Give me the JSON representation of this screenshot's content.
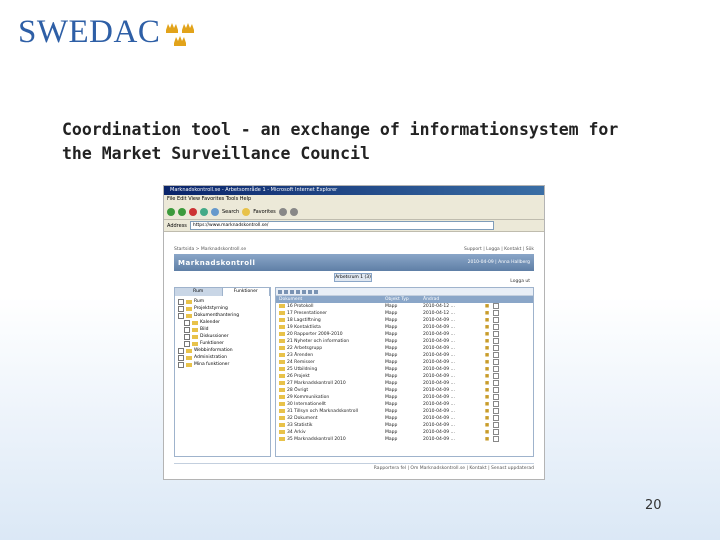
{
  "logo": {
    "text": "SWEDAC"
  },
  "slide": {
    "title_line1": "Coordination tool - an exchange of informationsystem for",
    "title_line2": "the Market Surveillance Council",
    "page_number": "20"
  },
  "browser": {
    "window_title": "Marknadskontroll.se - Arbetsområde 1 - Microsoft Internet Explorer",
    "menu": "File  Edit  View  Favorites  Tools  Help",
    "toolbar": {
      "search_label": "Search",
      "favorites_label": "Favorites"
    },
    "address_label": "Address",
    "address_value": "https://www.marknadskontroll.se/"
  },
  "app": {
    "breadcrumb": "Startsida > Marknadskontroll.se",
    "top_links": "Support | Logga | Kontakt | Sök",
    "title": "Marknadskontroll",
    "user_date": "2010-04-09 | Anna Hallberg",
    "center_tab": "Arbetsrum 1 (3)",
    "logout": "Logga ut",
    "left_tabs": [
      "Rum",
      "Funktioner"
    ],
    "tree": [
      "Rum",
      "Projektstyrning",
      "Dokumenthantering",
      "Kalender",
      "Bild",
      "Diskussioner",
      "Funktioner",
      "Webbinformation",
      "Administration",
      "Mina funktioner"
    ],
    "table": {
      "headers": [
        "Dokument",
        "Objekt Typ",
        "Ändrad"
      ],
      "rows": [
        [
          "16 Protokoll",
          "Mapp",
          "2010-04-12 ..."
        ],
        [
          "17 Presentationer",
          "Mapp",
          "2010-04-12 ..."
        ],
        [
          "18 Lagstiftning",
          "Mapp",
          "2010-04-09 ..."
        ],
        [
          "19 Kontaktlista",
          "Mapp",
          "2010-04-09 ..."
        ],
        [
          "20 Rapporter 2009-2010",
          "Mapp",
          "2010-04-09 ..."
        ],
        [
          "21 Nyheter och information",
          "Mapp",
          "2010-04-09 ..."
        ],
        [
          "22 Arbetsgrupp",
          "Mapp",
          "2010-04-09 ..."
        ],
        [
          "23 Ärenden",
          "Mapp",
          "2010-04-09 ..."
        ],
        [
          "24 Remisser",
          "Mapp",
          "2010-04-09 ..."
        ],
        [
          "25 Utbildning",
          "Mapp",
          "2010-04-09 ..."
        ],
        [
          "26 Projekt",
          "Mapp",
          "2010-04-09 ..."
        ],
        [
          "27 Marknadskontroll 2010",
          "Mapp",
          "2010-04-09 ..."
        ],
        [
          "28 Övrigt",
          "Mapp",
          "2010-04-09 ..."
        ],
        [
          "29 Kommunikation",
          "Mapp",
          "2010-04-09 ..."
        ],
        [
          "30 Internationellt",
          "Mapp",
          "2010-04-09 ..."
        ],
        [
          "31 Tillsyn och Marknadskontroll",
          "Mapp",
          "2010-04-09 ..."
        ],
        [
          "32 Dokument",
          "Mapp",
          "2010-04-09 ..."
        ],
        [
          "33 Statistik",
          "Mapp",
          "2010-04-09 ..."
        ],
        [
          "34 Arkiv",
          "Mapp",
          "2010-04-09 ..."
        ],
        [
          "35 Marknadskontroll 2010",
          "Mapp",
          "2010-04-09 ..."
        ]
      ]
    },
    "footer": "Rapportera fel | Om Marknadskontroll.se | Kontakt | Senast uppdaterad"
  },
  "colors": {
    "logo_blue": "#2e5fa6",
    "crown_gold": "#e2a31a",
    "header_blue": "#5f7fa6"
  }
}
